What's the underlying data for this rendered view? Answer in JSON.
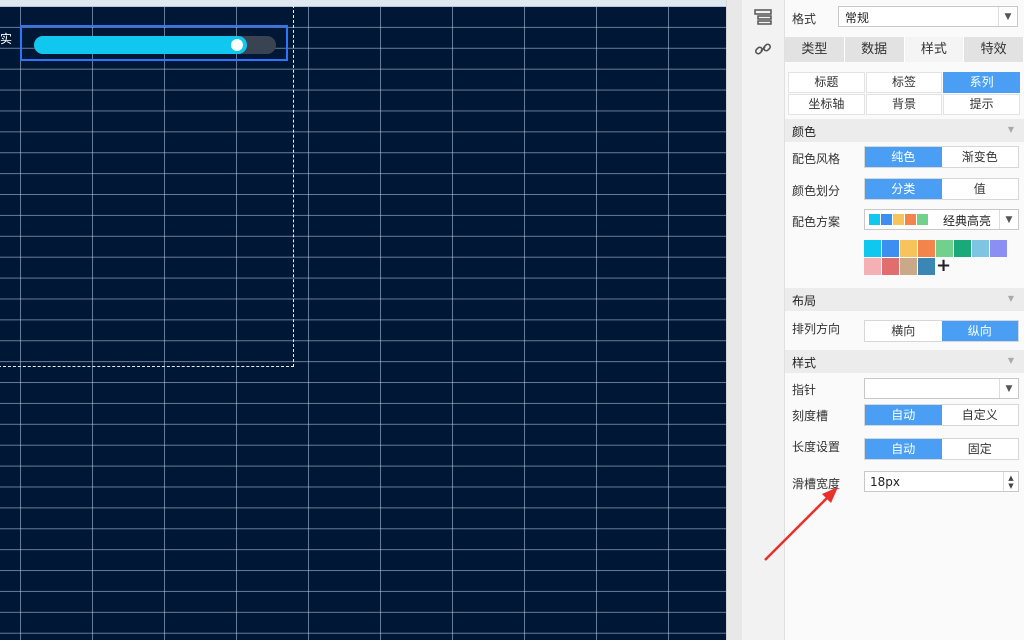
{
  "canvas": {
    "row_label": "实",
    "progress": {
      "value_fraction": 0.88,
      "fill_color": "#10c7ef",
      "track_color": "#3a4352"
    },
    "background_color": "#001736"
  },
  "panel": {
    "format_label": "格式",
    "format_value": "常规",
    "tabs": [
      {
        "label": "类型",
        "active": false
      },
      {
        "label": "数据",
        "active": false
      },
      {
        "label": "样式",
        "active": true
      },
      {
        "label": "特效",
        "active": false
      }
    ],
    "subtabs": [
      {
        "label": "标题",
        "active": false
      },
      {
        "label": "标签",
        "active": false
      },
      {
        "label": "系列",
        "active": true
      },
      {
        "label": "坐标轴",
        "active": false
      },
      {
        "label": "背景",
        "active": false
      },
      {
        "label": "提示",
        "active": false
      }
    ],
    "color_section": {
      "title": "颜色",
      "style_label": "配色风格",
      "style_options": [
        "纯色",
        "渐变色"
      ],
      "divide_label": "颜色划分",
      "divide_options": [
        "分类",
        "值"
      ],
      "scheme_label": "配色方案",
      "scheme_value": "经典高亮",
      "scheme_preview_colors": [
        "#10c7ef",
        "#3c8ef0",
        "#f7c35b",
        "#f3854c",
        "#71d08b"
      ],
      "palette_colors": [
        "#10c7ef",
        "#3c8ef0",
        "#f7c35b",
        "#f3854c",
        "#71d08b",
        "#1aa979",
        "#7ec5e4",
        "#8b8ff3",
        "#f5b0b5",
        "#e16e6e",
        "#c9a98a",
        "#3a87b5"
      ],
      "add_symbol": "+"
    },
    "layout_section": {
      "title": "布局",
      "direction_label": "排列方向",
      "direction_options": [
        "横向",
        "纵向"
      ]
    },
    "style_section": {
      "title": "样式",
      "pointer_label": "指针",
      "pointer_value": "",
      "scale_label": "刻度槽",
      "scale_options": [
        "自动",
        "自定义"
      ],
      "length_label": "长度设置",
      "length_options": [
        "自动",
        "固定"
      ],
      "width_label": "滑槽宽度",
      "width_value": "18px"
    },
    "accent_color": "#4a9ff5"
  },
  "annotation": {
    "arrow_color": "#e8312a"
  }
}
